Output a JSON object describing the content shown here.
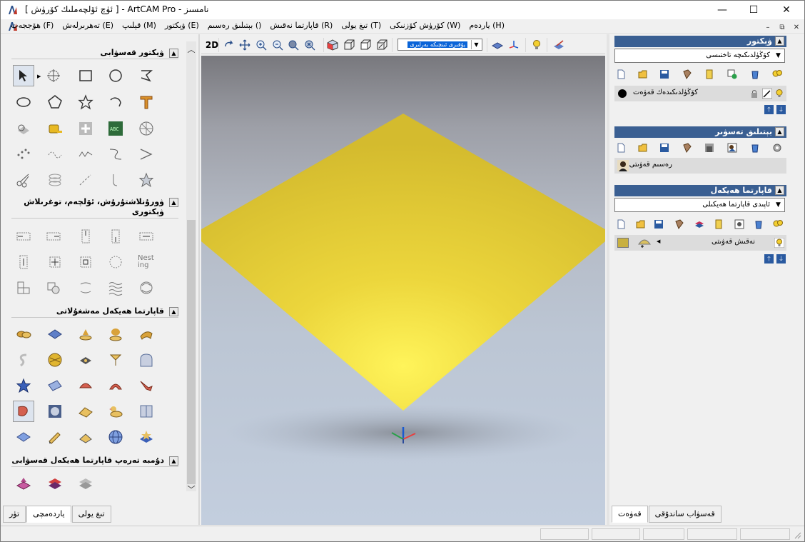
{
  "window": {
    "title": "[ ئۈچ ئۆلچەملىك كۆرۈش ] - ArtCAM Pro - نامسىز",
    "minimize_glyph": "—",
    "maximize_glyph": "☐",
    "close_glyph": "✕"
  },
  "menu": {
    "items": [
      "ياردەم (H)",
      "كۆرۈش كۆزنىكى (W)",
      "تىغ يولى (T)",
      "قاپارتما نەقىش (R)",
      "بېتىلىق رەسىم ()",
      "ۋېكتور (E)",
      "قېلىپ (M)",
      "تەھرىرلەش (E)",
      "ھۆججەت (F)"
    ],
    "mdi_minimize": "–",
    "mdi_restore": "⧉",
    "mdi_close": "✕"
  },
  "left_panel": {
    "sections": {
      "vector_create": "ۋېكتور قەسۋابى",
      "vector_arrange": "ۋورۇنلاشتۇرۇش، ئۆلچەم، توغرىلاش ۋېكتورى",
      "relief_ops": "قاپارتما ھەيكەل مەشغۇلاتى",
      "relief_layer": "دۇمبە تەرەپ قاپارتما ھەيكەل قەسۋابى"
    },
    "nesting_label": "Nesting",
    "tabs": [
      "تۈر",
      "ياردەمچى",
      "تىغ يولى"
    ],
    "active_tab": "ياردەمچى"
  },
  "view_toolbar": {
    "mode_2d": "2D",
    "view_select": "يۇقىرى ئىنچىكە بەرلىرى"
  },
  "right_panel": {
    "vector": {
      "title": "ۋېكتور",
      "combo": "كۆڭۈلدىكىچە تاختىسى",
      "layer_name": "كۆڭۈلدىكىدەك قەۋەت"
    },
    "bitmap": {
      "title": "بېتىلىق تەسۋىر",
      "layer_name": "رەسىم قەۋىتى"
    },
    "relief": {
      "title": "قاپارتما ھەيكەل",
      "combo": "ئاپىدى قاپارتما ھەيكىلى",
      "layer_name": "نەقىش قەۋىتى"
    },
    "tabs": [
      "قەۋەت",
      "قەسۋاب ساندۇقى"
    ],
    "active_tab": "قەۋەت"
  },
  "colors": {
    "panel_header": "#3a5f92",
    "relief_surface": "#e6c830",
    "accent": "#0a64d8"
  }
}
